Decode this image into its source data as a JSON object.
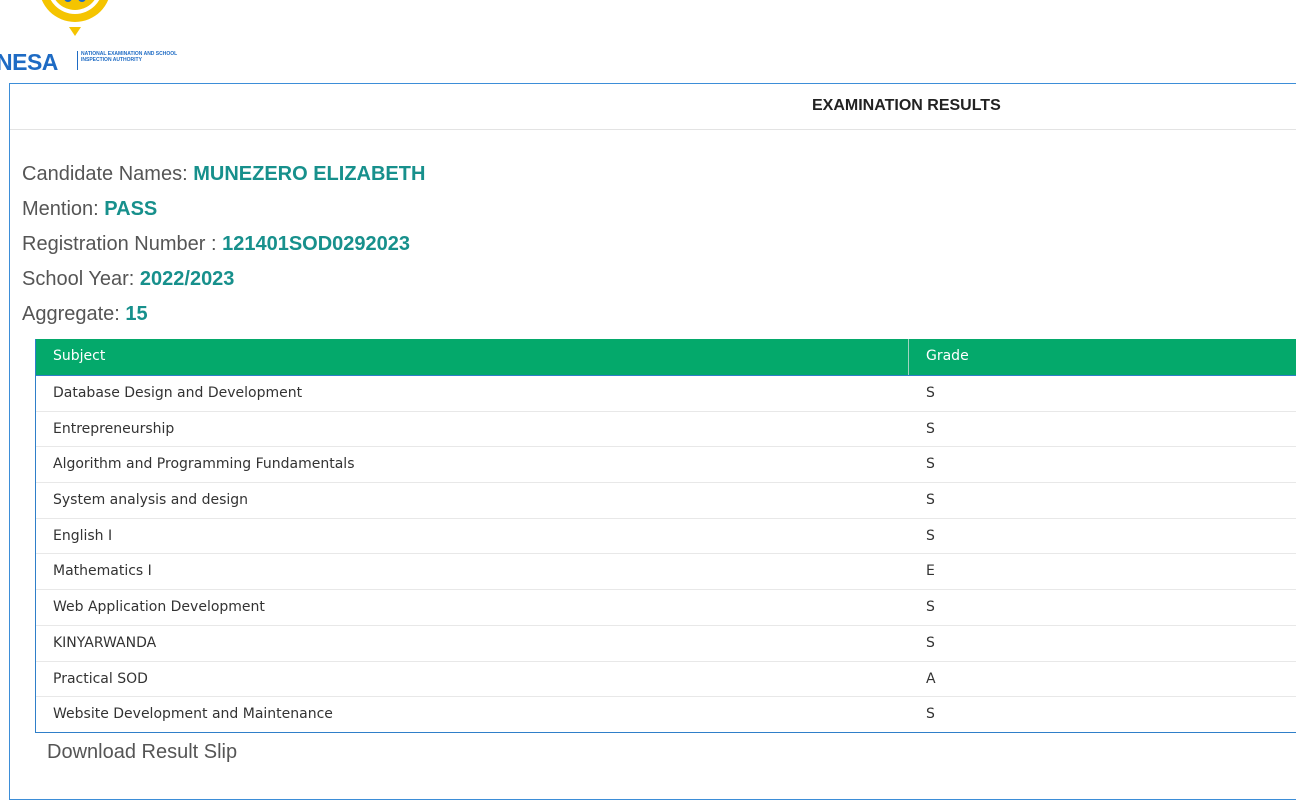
{
  "logo": {
    "wordmark": "NESA",
    "subtitle": "NATIONAL EXAMINATION AND SCHOOL INSPECTION AUTHORITY"
  },
  "panel": {
    "title": "EXAMINATION RESULTS"
  },
  "candidate": {
    "name_label": "Candidate Names:",
    "name": "MUNEZERO ELIZABETH",
    "mention_label": "Mention:",
    "mention": "PASS",
    "reg_label": "Registration Number :",
    "reg_number": "121401SOD0292023",
    "year_label": "School Year:",
    "year": "2022/2023",
    "aggregate_label": "Aggregate:",
    "aggregate": "15"
  },
  "table": {
    "headers": [
      "Subject",
      "Grade"
    ],
    "rows": [
      [
        "Database Design and Development",
        "S"
      ],
      [
        "Entrepreneurship",
        "S"
      ],
      [
        "Algorithm and Programming Fundamentals",
        "S"
      ],
      [
        "System analysis and design",
        "S"
      ],
      [
        "English I",
        "S"
      ],
      [
        "Mathematics I",
        "E"
      ],
      [
        "Web Application Development",
        "S"
      ],
      [
        "KINYARWANDA",
        "S"
      ],
      [
        "Practical SOD",
        "A"
      ],
      [
        "Website Development and Maintenance",
        "S"
      ]
    ]
  },
  "download_label": "Download Result Slip",
  "colors": {
    "accent_teal": "#17908c",
    "header_green": "#04a96b",
    "brand_blue": "#1e6bc4",
    "brand_yellow": "#f5c400"
  }
}
